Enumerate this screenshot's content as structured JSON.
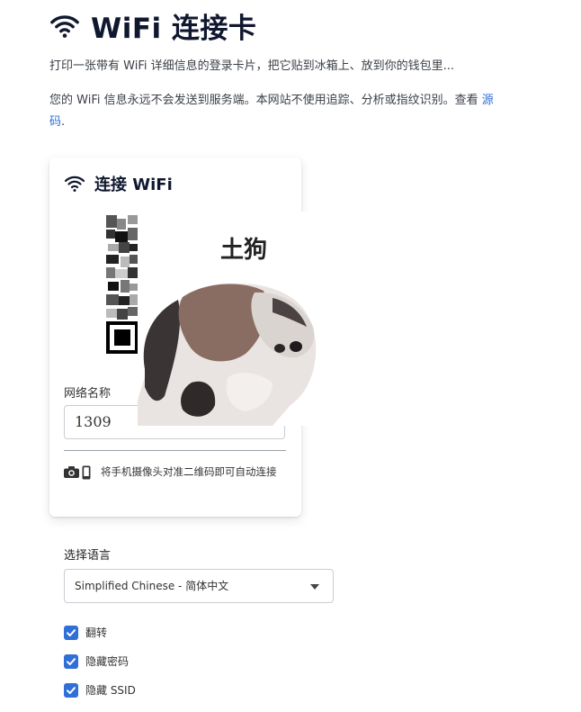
{
  "header": {
    "title": "WiFi 连接卡",
    "icon": "wifi-icon"
  },
  "intro": {
    "line1": "打印一张带有 WiFi 详细信息的登录卡片，把它贴到冰箱上、放到你的钱包里...",
    "line2_prefix": "您的 WiFi 信息永远不会发送到服务端。本网站不使用追踪、分析或指纹识别。查看 ",
    "source_link": "源码",
    "line2_suffix": "."
  },
  "card": {
    "title": "连接 WiFi",
    "ssid_label": "网络名称",
    "ssid_value": "1309",
    "hint": "将手机摄像头对准二维码即可自动连接",
    "hint_icons": [
      "camera-icon",
      "phone-icon"
    ],
    "meme_caption": "土狗"
  },
  "language": {
    "label": "选择语言",
    "selected": "Simplified Chinese - 简体中文"
  },
  "options": [
    {
      "label": "翻转",
      "checked": true
    },
    {
      "label": "隐藏密码",
      "checked": true
    },
    {
      "label": "隐藏 SSID",
      "checked": true
    }
  ],
  "colors": {
    "accent": "#2f6fd6",
    "title": "#10182f"
  }
}
